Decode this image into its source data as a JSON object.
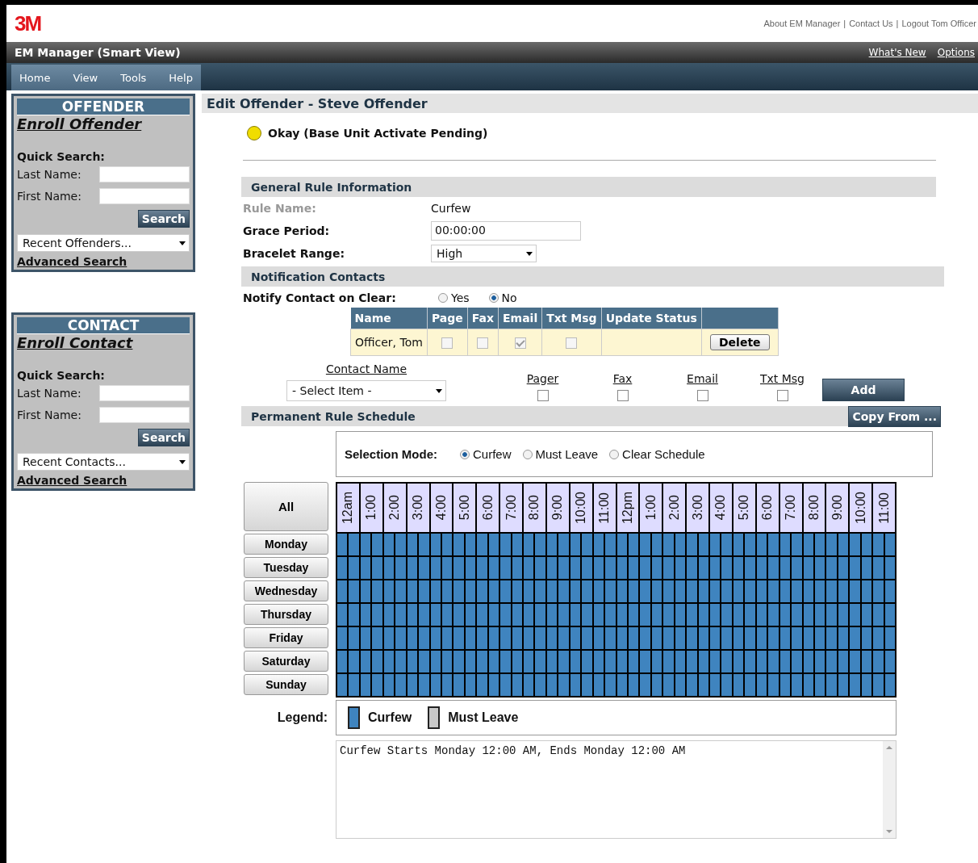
{
  "header": {
    "logo": "3M",
    "separator": "|",
    "links": [
      "About EM Manager",
      "Contact Us",
      "Logout Tom Officer"
    ]
  },
  "app_bar": {
    "title": "EM Manager (Smart View)",
    "links": [
      "What's New",
      "Options"
    ]
  },
  "menu": [
    "Home",
    "View",
    "Tools",
    "Help"
  ],
  "sidebar_panels": [
    {
      "title": "OFFENDER",
      "enroll_link": "Enroll Offender",
      "quick_search": "Quick Search:",
      "fields": [
        {
          "label": "Last Name:"
        },
        {
          "label": "First Name:"
        }
      ],
      "search_button": "Search",
      "recent_dropdown": "Recent Offenders...",
      "advanced_link": "Advanced Search"
    },
    {
      "title": "CONTACT",
      "enroll_link": "Enroll Contact",
      "quick_search": "Quick Search:",
      "fields": [
        {
          "label": "Last Name:"
        },
        {
          "label": "First Name:"
        }
      ],
      "search_button": "Search",
      "recent_dropdown": "Recent Contacts...",
      "advanced_link": "Advanced Search"
    }
  ],
  "page_title": "Edit Offender - Steve Offender",
  "status": {
    "text": "Okay (Base Unit Activate Pending)"
  },
  "general_rule": {
    "heading": "General Rule Information",
    "rows": [
      {
        "label": "Rule Name:",
        "kind": "text",
        "value": "Curfew",
        "disabled": true
      },
      {
        "label": "Grace Period:",
        "kind": "input",
        "value": "00:00:00",
        "disabled": false
      },
      {
        "label": "Bracelet Range:",
        "kind": "select",
        "value": "High",
        "disabled": false
      }
    ]
  },
  "notification": {
    "heading": "Notification Contacts",
    "notify_label": "Notify Contact on Clear:",
    "options": [
      {
        "label": "Yes",
        "selected": false
      },
      {
        "label": "No",
        "selected": true
      }
    ],
    "table": {
      "columns": [
        "Name",
        "Page",
        "Fax",
        "Email",
        "Txt Msg",
        "Update Status"
      ],
      "rows": [
        {
          "name": "Officer, Tom",
          "page": false,
          "fax": false,
          "email": true,
          "txt_msg": false,
          "action": "Delete"
        }
      ]
    },
    "add_form": {
      "headers": [
        "Contact Name",
        "Pager",
        "Fax",
        "Email",
        "Txt Msg"
      ],
      "select": "- Select Item -",
      "checks": [
        false,
        false,
        false,
        false
      ],
      "add_button": "Add"
    }
  },
  "schedule": {
    "heading": "Permanent Rule Schedule",
    "copy_button": "Copy From ...",
    "mode_label": "Selection Mode:",
    "modes": [
      {
        "label": "Curfew",
        "selected": true
      },
      {
        "label": "Must Leave",
        "selected": false
      },
      {
        "label": "Clear Schedule",
        "selected": false
      }
    ],
    "all_button": "All",
    "hours": [
      "12am",
      "1:00",
      "2:00",
      "3:00",
      "4:00",
      "5:00",
      "6:00",
      "7:00",
      "8:00",
      "9:00",
      "10:00",
      "11:00",
      "12pm",
      "1:00",
      "2:00",
      "3:00",
      "4:00",
      "5:00",
      "6:00",
      "7:00",
      "8:00",
      "9:00",
      "10:00",
      "11:00"
    ],
    "days": [
      {
        "label": "Monday",
        "curfew": [
          true,
          true,
          true,
          true,
          true,
          true,
          true,
          true,
          true,
          true,
          true,
          true,
          true,
          true,
          true,
          true,
          true,
          true,
          true,
          true,
          true,
          true,
          true,
          true,
          true,
          true,
          true,
          true,
          true,
          true,
          true,
          true,
          true,
          true,
          true,
          true,
          true,
          true,
          true,
          true,
          true,
          true,
          true,
          true,
          true,
          true,
          true,
          true
        ]
      },
      {
        "label": "Tuesday",
        "curfew": [
          true,
          true,
          true,
          true,
          true,
          true,
          true,
          true,
          true,
          true,
          true,
          true,
          true,
          true,
          true,
          true,
          true,
          true,
          true,
          true,
          true,
          true,
          true,
          true,
          true,
          true,
          true,
          true,
          true,
          true,
          true,
          true,
          true,
          true,
          true,
          true,
          true,
          true,
          true,
          true,
          true,
          true,
          true,
          true,
          true,
          true,
          true,
          true
        ]
      },
      {
        "label": "Wednesday",
        "curfew": [
          true,
          true,
          true,
          true,
          true,
          true,
          true,
          true,
          true,
          true,
          true,
          true,
          true,
          true,
          true,
          true,
          true,
          true,
          true,
          true,
          true,
          true,
          true,
          true,
          true,
          true,
          true,
          true,
          true,
          true,
          true,
          true,
          true,
          true,
          true,
          true,
          true,
          true,
          true,
          true,
          true,
          true,
          true,
          true,
          true,
          true,
          true,
          true
        ]
      },
      {
        "label": "Thursday",
        "curfew": [
          true,
          true,
          true,
          true,
          true,
          true,
          true,
          true,
          true,
          true,
          true,
          true,
          true,
          true,
          true,
          true,
          true,
          true,
          true,
          true,
          true,
          true,
          true,
          true,
          true,
          true,
          true,
          true,
          true,
          true,
          true,
          true,
          true,
          true,
          true,
          true,
          true,
          true,
          true,
          true,
          true,
          true,
          true,
          true,
          true,
          true,
          true,
          true
        ]
      },
      {
        "label": "Friday",
        "curfew": [
          true,
          true,
          true,
          true,
          true,
          true,
          true,
          true,
          true,
          true,
          true,
          true,
          true,
          true,
          true,
          true,
          true,
          true,
          true,
          true,
          true,
          true,
          true,
          true,
          true,
          true,
          true,
          true,
          true,
          true,
          true,
          true,
          true,
          true,
          true,
          true,
          true,
          true,
          true,
          true,
          true,
          true,
          true,
          true,
          true,
          true,
          true,
          true
        ]
      },
      {
        "label": "Saturday",
        "curfew": [
          true,
          true,
          true,
          true,
          true,
          true,
          true,
          true,
          true,
          true,
          true,
          true,
          true,
          true,
          true,
          true,
          true,
          true,
          true,
          true,
          true,
          true,
          true,
          true,
          true,
          true,
          true,
          true,
          true,
          true,
          true,
          true,
          true,
          true,
          true,
          true,
          true,
          true,
          true,
          true,
          true,
          true,
          true,
          true,
          true,
          true,
          true,
          true
        ]
      },
      {
        "label": "Sunday",
        "curfew": [
          true,
          true,
          true,
          true,
          true,
          true,
          true,
          true,
          true,
          true,
          true,
          true,
          true,
          true,
          true,
          true,
          true,
          true,
          true,
          true,
          true,
          true,
          true,
          true,
          true,
          true,
          true,
          true,
          true,
          true,
          true,
          true,
          true,
          true,
          true,
          true,
          true,
          true,
          true,
          true,
          true,
          true,
          true,
          true,
          true,
          true,
          true,
          true
        ]
      }
    ],
    "legend_label": "Legend:",
    "legend": [
      {
        "label": "Curfew",
        "color": "#3f84bf"
      },
      {
        "label": "Must Leave",
        "color": "#c8c8c8"
      }
    ],
    "summary": "Curfew Starts Monday 12:00 AM, Ends Monday 12:00 AM"
  }
}
